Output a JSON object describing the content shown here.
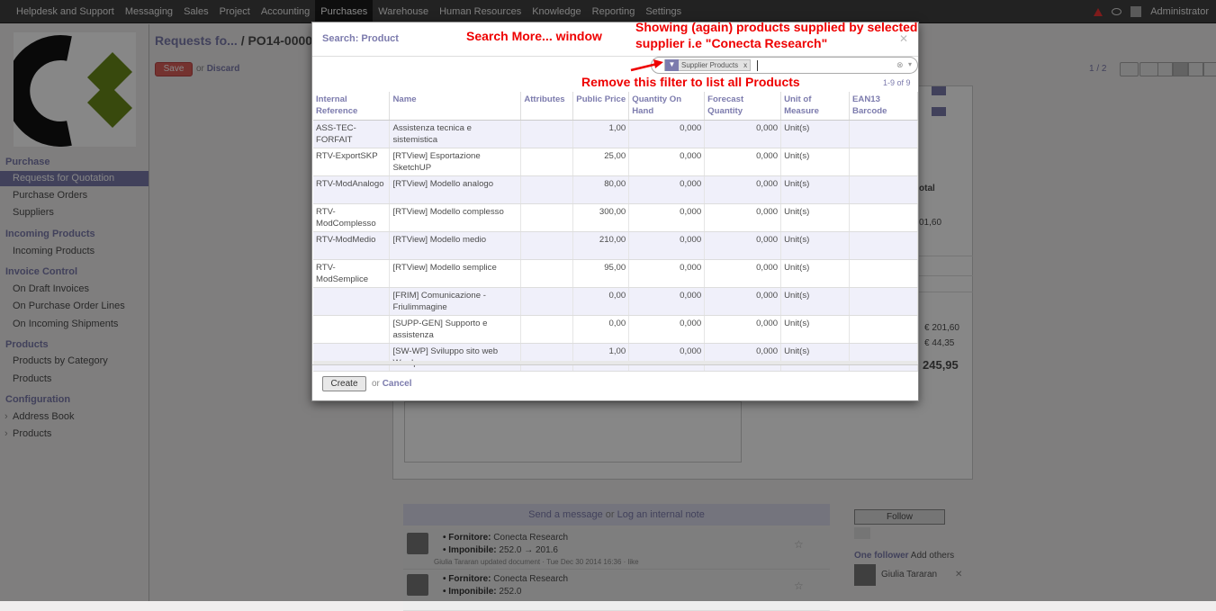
{
  "topnav": {
    "items": [
      "Helpdesk and Support",
      "Messaging",
      "Sales",
      "Project",
      "Accounting",
      "Purchases",
      "Warehouse",
      "Human Resources",
      "Knowledge",
      "Reporting",
      "Settings"
    ],
    "active": "Purchases",
    "user": "Administrator"
  },
  "sidebar": {
    "sections": [
      {
        "title": "Purchase",
        "items": [
          "Requests for Quotation",
          "Purchase Orders",
          "Suppliers"
        ]
      },
      {
        "title": "Incoming Products",
        "items": [
          "Incoming Products"
        ]
      },
      {
        "title": "Invoice Control",
        "items": [
          "On Draft Invoices",
          "On Purchase Order Lines",
          "On Incoming Shipments"
        ]
      },
      {
        "title": "Products",
        "items": [
          "Products by Category",
          "Products"
        ]
      },
      {
        "title": "Configuration",
        "items": [
          "Address Book",
          "Products"
        ]
      }
    ]
  },
  "form": {
    "breadcrumb": "Requests fo...",
    "record_id": "/ PO14-0000",
    "save_label": "Save",
    "or_label": "or",
    "discard_label": "Discard",
    "pager": "1 / 2",
    "subtotal_header": "otal",
    "line_amount": "01,60",
    "untaxed": "€ 201,60",
    "taxes": "€ 44,35",
    "total": "245,95"
  },
  "chatter": {
    "send_message": "Send a message",
    "or": "or",
    "log_note": "Log an internal note",
    "messages": [
      {
        "line1_label": "• Fornitore:",
        "line1_value": "Conecta Research",
        "line2_label": "• Imponibile:",
        "line2_value": "252.0 → 201.6",
        "meta": "Giulia Tararan updated document · Tue Dec 30 2014 16:36 · like"
      },
      {
        "line1_label": "• Fornitore:",
        "line1_value": "Conecta Research",
        "line2_label": "• Imponibile:",
        "line2_value": "252.0",
        "meta": ""
      }
    ],
    "follow_label": "Follow",
    "followers_label": "One follower",
    "add_others": "Add others",
    "follower_name": "Giulia Tararan"
  },
  "modal": {
    "title": "Search: Product",
    "facet_label": "Supplier Products",
    "facet_remove": "x",
    "search_value": "",
    "count": "1-9 of 9",
    "columns": [
      "Internal Reference",
      "Name",
      "Attributes",
      "Public Price",
      "Quantity On Hand",
      "Forecast Quantity",
      "Unit of Measure",
      "EAN13 Barcode"
    ],
    "rows": [
      {
        "ref": "ASS-TEC-FORFAIT",
        "name": "Assistenza tecnica e sistemistica",
        "attr": "",
        "price": "1,00",
        "qoh": "0,000",
        "fq": "0,000",
        "uom": "Unit(s)",
        "ean": ""
      },
      {
        "ref": "RTV-ExportSKP",
        "name": "[RTView] Esportazione SketchUP",
        "attr": "",
        "price": "25,00",
        "qoh": "0,000",
        "fq": "0,000",
        "uom": "Unit(s)",
        "ean": ""
      },
      {
        "ref": "RTV-ModAnalogo",
        "name": "[RTView] Modello analogo",
        "attr": "",
        "price": "80,00",
        "qoh": "0,000",
        "fq": "0,000",
        "uom": "Unit(s)",
        "ean": ""
      },
      {
        "ref": "RTV-ModComplesso",
        "name": "[RTView] Modello complesso",
        "attr": "",
        "price": "300,00",
        "qoh": "0,000",
        "fq": "0,000",
        "uom": "Unit(s)",
        "ean": ""
      },
      {
        "ref": "RTV-ModMedio",
        "name": "[RTView] Modello medio",
        "attr": "",
        "price": "210,00",
        "qoh": "0,000",
        "fq": "0,000",
        "uom": "Unit(s)",
        "ean": ""
      },
      {
        "ref": "RTV-ModSemplice",
        "name": "[RTView] Modello semplice",
        "attr": "",
        "price": "95,00",
        "qoh": "0,000",
        "fq": "0,000",
        "uom": "Unit(s)",
        "ean": ""
      },
      {
        "ref": "",
        "name": "[FRIM] Comunicazione - Friulimmagine",
        "attr": "",
        "price": "0,00",
        "qoh": "0,000",
        "fq": "0,000",
        "uom": "Unit(s)",
        "ean": ""
      },
      {
        "ref": "",
        "name": "[SUPP-GEN] Supporto e assistenza",
        "attr": "",
        "price": "0,00",
        "qoh": "0,000",
        "fq": "0,000",
        "uom": "Unit(s)",
        "ean": ""
      },
      {
        "ref": "",
        "name": "[SW-WP] Sviluppo sito web Wordpress",
        "attr": "",
        "price": "1,00",
        "qoh": "0,000",
        "fq": "0,000",
        "uom": "Unit(s)",
        "ean": ""
      }
    ],
    "create_label": "Create",
    "or_label": "or",
    "cancel_label": "Cancel"
  },
  "annotations": {
    "window": "Search More... window",
    "showing_line1": "Showing (again) products supplied by selected",
    "showing_line2": "supplier i.e \"Conecta Research\"",
    "remove": "Remove this filter to list all Products"
  },
  "colors": {
    "accent": "#7c7bad",
    "annotation": "#ee0000",
    "save": "#dc5f59"
  }
}
